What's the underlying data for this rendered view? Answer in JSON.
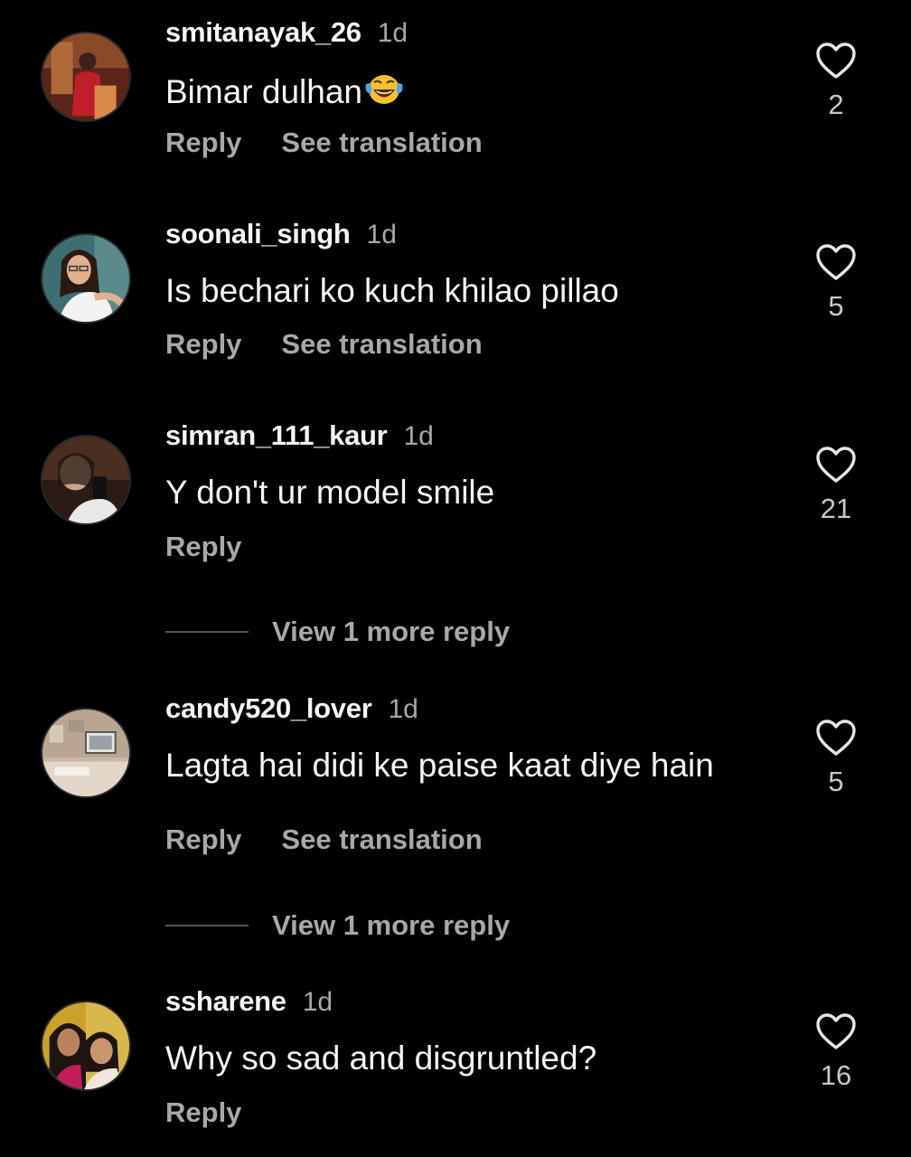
{
  "colors": {
    "background": "#000000",
    "primary_text": "#f5f5f5",
    "secondary_text": "#a8a8a8"
  },
  "comments": [
    {
      "username": "smitanayak_26",
      "time": "1d",
      "text": "Bimar dulhan",
      "emoji": "laughing-tears-emoji",
      "likes": "2",
      "reply_label": "Reply",
      "translate_label": "See translation"
    },
    {
      "username": "soonali_singh",
      "time": "1d",
      "text": "Is bechari ko kuch khilao pillao",
      "likes": "5",
      "reply_label": "Reply",
      "translate_label": "See translation"
    },
    {
      "username": "simran_111_kaur",
      "time": "1d",
      "text": "Y don't ur model smile",
      "likes": "21",
      "reply_label": "Reply",
      "view_replies_label": "View 1 more reply"
    },
    {
      "username": "candy520_lover",
      "time": "1d",
      "text": "Lagta hai didi ke paise kaat diye hain",
      "likes": "5",
      "reply_label": "Reply",
      "translate_label": "See translation",
      "view_replies_label": "View 1 more reply"
    },
    {
      "username": "ssharene",
      "time": "1d",
      "text": "Why so sad and disgruntled?",
      "likes": "16",
      "reply_label": "Reply"
    }
  ]
}
